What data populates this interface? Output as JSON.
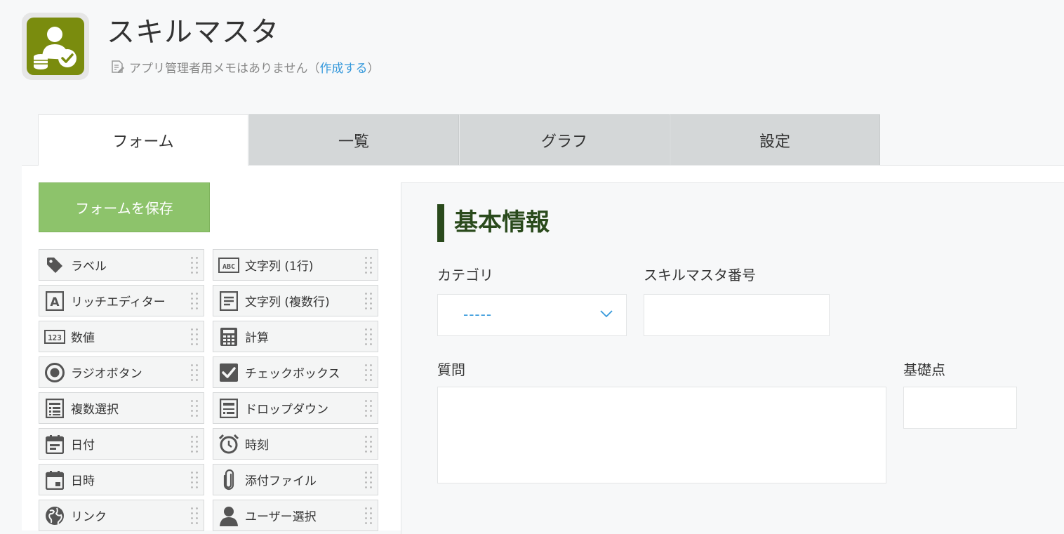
{
  "app": {
    "title": "スキルマスタ",
    "memo_text": "アプリ管理者用メモはありません",
    "memo_open": "（",
    "memo_link": "作成する",
    "memo_close": "）",
    "icon_color": "#7a8c0e"
  },
  "tabs": [
    {
      "label": "フォーム",
      "active": true
    },
    {
      "label": "一覧",
      "active": false
    },
    {
      "label": "グラフ",
      "active": false
    },
    {
      "label": "設定",
      "active": false
    }
  ],
  "toolbar": {
    "save_label": "フォームを保存",
    "save_color": "#8dc36b"
  },
  "palette": [
    {
      "label": "ラベル",
      "icon": "tag-icon"
    },
    {
      "label": "文字列 (1行)",
      "icon": "abc-text-icon"
    },
    {
      "label": "リッチエディター",
      "icon": "rich-editor-icon"
    },
    {
      "label": "文字列 (複数行)",
      "icon": "multiline-text-icon"
    },
    {
      "label": "数値",
      "icon": "number-123-icon"
    },
    {
      "label": "計算",
      "icon": "calculator-icon"
    },
    {
      "label": "ラジオボタン",
      "icon": "radio-icon"
    },
    {
      "label": "チェックボックス",
      "icon": "checkbox-icon"
    },
    {
      "label": "複数選択",
      "icon": "multi-select-icon"
    },
    {
      "label": "ドロップダウン",
      "icon": "dropdown-icon"
    },
    {
      "label": "日付",
      "icon": "date-icon"
    },
    {
      "label": "時刻",
      "icon": "alarm-clock-icon"
    },
    {
      "label": "日時",
      "icon": "datetime-icon"
    },
    {
      "label": "添付ファイル",
      "icon": "paperclip-icon"
    },
    {
      "label": "リンク",
      "icon": "globe-icon"
    },
    {
      "label": "ユーザー選択",
      "icon": "user-icon"
    }
  ],
  "form": {
    "section_title": "基本情報",
    "section_color": "#2a4a1c",
    "category": {
      "label": "カテゴリ",
      "value": "-----"
    },
    "skill_number": {
      "label": "スキルマスタ番号",
      "value": ""
    },
    "question": {
      "label": "質問",
      "value": ""
    },
    "base_points": {
      "label": "基礎点",
      "value": ""
    }
  }
}
